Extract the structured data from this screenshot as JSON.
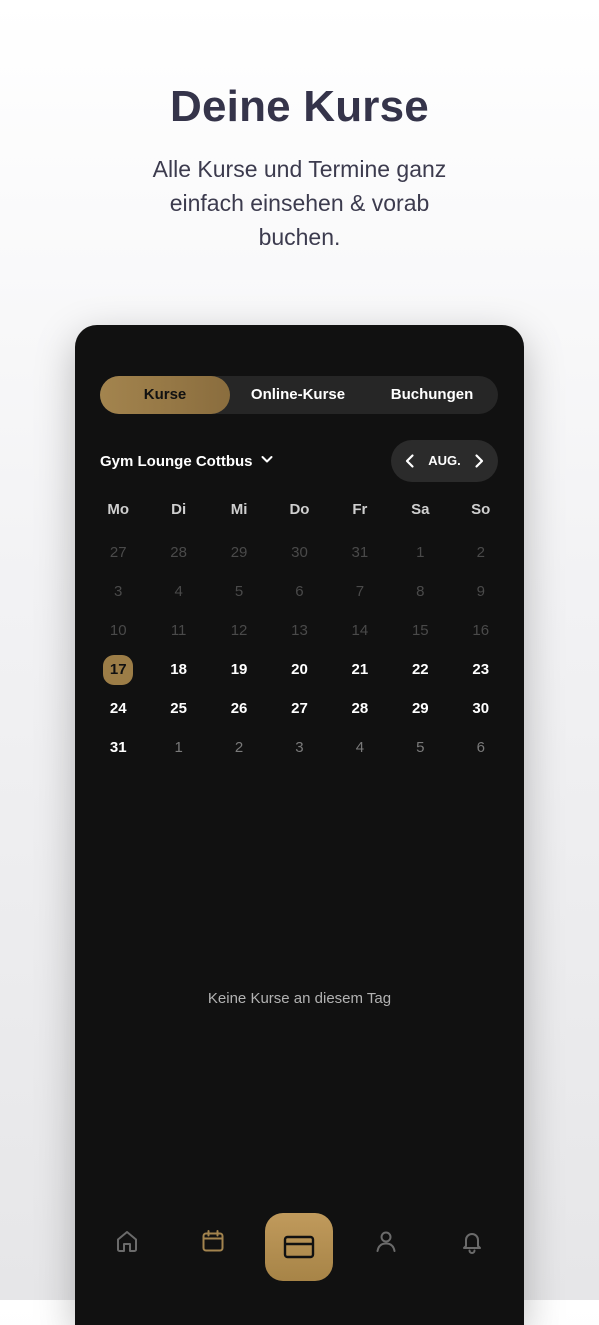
{
  "hero": {
    "title": "Deine Kurse",
    "subtitle": "Alle Kurse und Termine ganz einfach einsehen & vorab buchen."
  },
  "tabs": [
    {
      "label": "Kurse",
      "active": true
    },
    {
      "label": "Online-Kurse",
      "active": false
    },
    {
      "label": "Buchungen",
      "active": false
    }
  ],
  "location": {
    "label": "Gym Lounge Cottbus",
    "icon": "chevron-down-icon"
  },
  "month_nav": {
    "label": "AUG.",
    "prev_icon": "chevron-left-icon",
    "next_icon": "chevron-right-icon"
  },
  "calendar": {
    "weekdays": [
      "Mo",
      "Di",
      "Mi",
      "Do",
      "Fr",
      "Sa",
      "So"
    ],
    "selected_day": "17",
    "rows": [
      [
        "27",
        "28",
        "29",
        "30",
        "31",
        "1",
        "2"
      ],
      [
        "3",
        "4",
        "5",
        "6",
        "7",
        "8",
        "9"
      ],
      [
        "10",
        "11",
        "12",
        "13",
        "14",
        "15",
        "16"
      ],
      [
        "17",
        "18",
        "19",
        "20",
        "21",
        "22",
        "23"
      ],
      [
        "24",
        "25",
        "26",
        "27",
        "28",
        "29",
        "30"
      ],
      [
        "31",
        "1",
        "2",
        "3",
        "4",
        "5",
        "6"
      ]
    ]
  },
  "empty_message": "Keine Kurse an diesem Tag",
  "bottom_nav": {
    "items": [
      "home-icon",
      "calendar-icon",
      "card-icon",
      "profile-icon",
      "bell-icon"
    ],
    "active": "calendar-icon"
  },
  "colors": {
    "accent_gold": "#a3844e",
    "phone_bg": "#111111",
    "tab_bg": "#262626",
    "hero_text": "#35344a"
  }
}
